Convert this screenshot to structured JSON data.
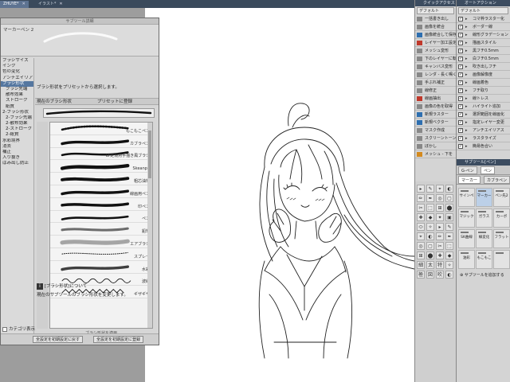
{
  "tabs": [
    {
      "label": "ZHUYE*",
      "active": true
    },
    {
      "label": "イラスト*",
      "active": false
    }
  ],
  "subtool_detail": {
    "title": "サブツール詳細",
    "tool_name": "マーカーペン 2",
    "categories": [
      {
        "label": "ブラシサイズ",
        "indent": false,
        "selected": false
      },
      {
        "label": "インク",
        "indent": false,
        "selected": false
      },
      {
        "label": "色の変化",
        "indent": false,
        "selected": false
      },
      {
        "label": "アンチエイリアス",
        "indent": false,
        "selected": false
      },
      {
        "label": "ブラシ形状",
        "indent": false,
        "selected": true
      },
      {
        "label": "ブラシ先端",
        "indent": true,
        "selected": false
      },
      {
        "label": "散布効果",
        "indent": true,
        "selected": false
      },
      {
        "label": "ストローク",
        "indent": true,
        "selected": false
      },
      {
        "label": "紙質",
        "indent": true,
        "selected": false
      },
      {
        "label": "2-ブラシ形状",
        "indent": false,
        "selected": false
      },
      {
        "label": "2-ブラシ先端",
        "indent": true,
        "selected": false
      },
      {
        "label": "2-散布効果",
        "indent": true,
        "selected": false
      },
      {
        "label": "2-ストローク",
        "indent": true,
        "selected": false
      },
      {
        "label": "2-紙質",
        "indent": true,
        "selected": false
      },
      {
        "label": "水彩境界",
        "indent": false,
        "selected": false
      },
      {
        "label": "消去",
        "indent": false,
        "selected": false
      },
      {
        "label": "補正",
        "indent": false,
        "selected": false
      },
      {
        "label": "入り抜き",
        "indent": false,
        "selected": false
      },
      {
        "label": "はみ出し防止",
        "indent": false,
        "selected": false
      }
    ],
    "show_category_label": "カテゴリ表示",
    "description": "ブラシ形状をプリセットから選択します。",
    "current_brush_label": "現在のブラシ形状",
    "register_preset_label": "プリセットに登録",
    "presets": [
      {
        "label": "もこもこペン",
        "selected": false
      },
      {
        "label": "カブラペン",
        "selected": false
      },
      {
        "label": "LT定規用手描き風ブラシ",
        "selected": false
      },
      {
        "label": "Skeanpa",
        "selected": false
      },
      {
        "label": "粗芯油筆",
        "selected": false
      },
      {
        "label": "線画用ペン",
        "selected": false
      },
      {
        "label": "印ペン",
        "selected": false
      },
      {
        "label": "ペン",
        "selected": false
      },
      {
        "label": "鉛筆",
        "selected": false
      },
      {
        "label": "エアブラシ",
        "selected": false
      },
      {
        "label": "スプレー",
        "selected": false
      },
      {
        "label": "水彩",
        "selected": false
      },
      {
        "label": "波線",
        "selected": false
      },
      {
        "label": "ギザギザ",
        "selected": false
      }
    ],
    "preset_footer": "ブラシ形状を適用",
    "info_title": "[ブラシ形状]について",
    "info_text": "現在のサブツールのブラシ形状を変更します。",
    "reset_all_label": "全設定を初期設定に戻す",
    "register_all_label": "全設定を初期設定に登録"
  },
  "quick_access": {
    "title": "クイックアクセス",
    "selector": "デフォルト",
    "items": [
      {
        "label": "一括書き出し",
        "icon": "gray"
      },
      {
        "label": "画像を統合",
        "icon": "gray"
      },
      {
        "label": "画像統合して保存",
        "icon": "blue"
      },
      {
        "label": "レイヤー加工設定",
        "icon": "red"
      },
      {
        "label": "メッシュ変形",
        "icon": "gray"
      },
      {
        "label": "下のレイヤーに転写",
        "icon": "gray"
      },
      {
        "label": "キャンバス変形",
        "icon": "gray"
      },
      {
        "label": "レンダ - 長く鳴く",
        "icon": "gray"
      },
      {
        "label": "手ぶれ補正",
        "icon": "gray"
      },
      {
        "label": "線修正",
        "icon": "gray"
      },
      {
        "label": "線画抽出",
        "icon": "red"
      },
      {
        "label": "画像の色を取得",
        "icon": "gray"
      },
      {
        "label": "新規ラスター",
        "icon": "blue"
      },
      {
        "label": "新規ベクター",
        "icon": "blue"
      },
      {
        "label": "マスク作成",
        "icon": "gray"
      },
      {
        "label": "スクリーントーン",
        "icon": "gray"
      },
      {
        "label": "ぼかし",
        "icon": "gray"
      },
      {
        "label": "メッシュ - 下を",
        "icon": "orange"
      }
    ]
  },
  "auto_action": {
    "title": "オートアクション",
    "selector": "デフォルト",
    "items": [
      {
        "label": "コマ枠ラスター化",
        "checked": true
      },
      {
        "label": "ボーダー線",
        "checked": true
      },
      {
        "label": "線形グラデーション",
        "checked": true
      },
      {
        "label": "描画スタイル",
        "checked": true
      },
      {
        "label": "黒フチ0.5mm",
        "checked": true
      },
      {
        "label": "白フチ0.5mm",
        "checked": true
      },
      {
        "label": "吹き出しフチ",
        "checked": true
      },
      {
        "label": "画像解像度",
        "checked": true
      },
      {
        "label": "線画着色",
        "checked": true
      },
      {
        "label": "フチ取り",
        "checked": true
      },
      {
        "label": "線トレス",
        "checked": true
      },
      {
        "label": "ハイライト追加",
        "checked": true
      },
      {
        "label": "選択範囲を線画化",
        "checked": true
      },
      {
        "label": "指定レイヤー変更",
        "checked": true
      },
      {
        "label": "アンチエイリアス",
        "checked": true
      },
      {
        "label": "ラスタライズ",
        "checked": true
      },
      {
        "label": "簡易色合い",
        "checked": true
      }
    ]
  },
  "subtool_panel": {
    "title": "サブツール[ペン]",
    "tab_primary": "G-ペン",
    "tab_marker": "マーカー",
    "tab_kaburapen": "カブラペン",
    "tools": [
      {
        "label": "サインペン",
        "selected": false
      },
      {
        "label": "マーカー",
        "selected": true
      },
      {
        "label": "ペン先2",
        "selected": false
      },
      {
        "label": "マジック",
        "selected": false
      },
      {
        "label": "ガラス",
        "selected": false
      },
      {
        "label": "カーボ",
        "selected": false
      },
      {
        "label": "SK曲線",
        "selected": false
      },
      {
        "label": "線変化",
        "selected": false
      },
      {
        "label": "フラットマーカー",
        "selected": false
      },
      {
        "label": "油彩",
        "selected": false
      },
      {
        "label": "もこもこ",
        "selected": false
      },
      {
        "label": "",
        "selected": false
      }
    ],
    "add_subtool_label": "サブツールを追加する"
  },
  "tool_palette_glyphs": [
    "細",
    "太",
    "特",
    "極",
    "図",
    "吹",
    "S",
    "X",
    "A",
    "T"
  ],
  "colors": {
    "accent": "#5577a0",
    "titlebar": "#3c4c60",
    "panel_bg": "#d4d4d4"
  }
}
